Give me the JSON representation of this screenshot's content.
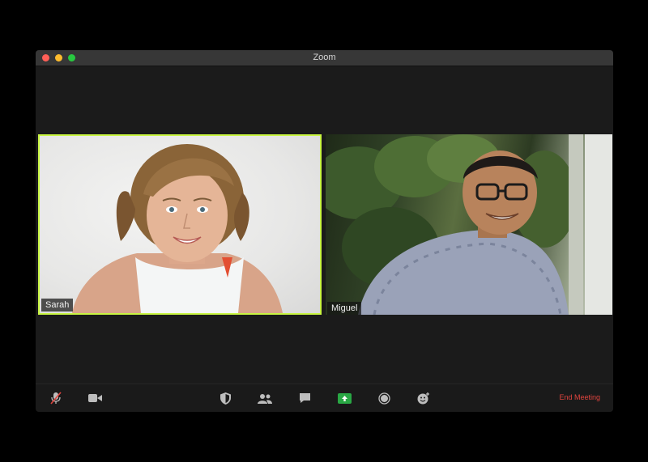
{
  "window": {
    "title": "Zoom"
  },
  "participants": [
    {
      "name": "Sarah",
      "active_speaker": true
    },
    {
      "name": "Miguel",
      "active_speaker": false
    }
  ],
  "toolbar": {
    "icons": [
      "microphone-muted-icon",
      "video-camera-icon",
      "security-shield-icon",
      "participants-icon",
      "chat-icon",
      "share-screen-icon",
      "record-icon",
      "reactions-icon"
    ],
    "end_meeting_label": "End Meeting"
  },
  "colors": {
    "active_speaker_border": "#c8f542",
    "share_screen": "#29a744",
    "end_meeting": "#e0443e"
  }
}
